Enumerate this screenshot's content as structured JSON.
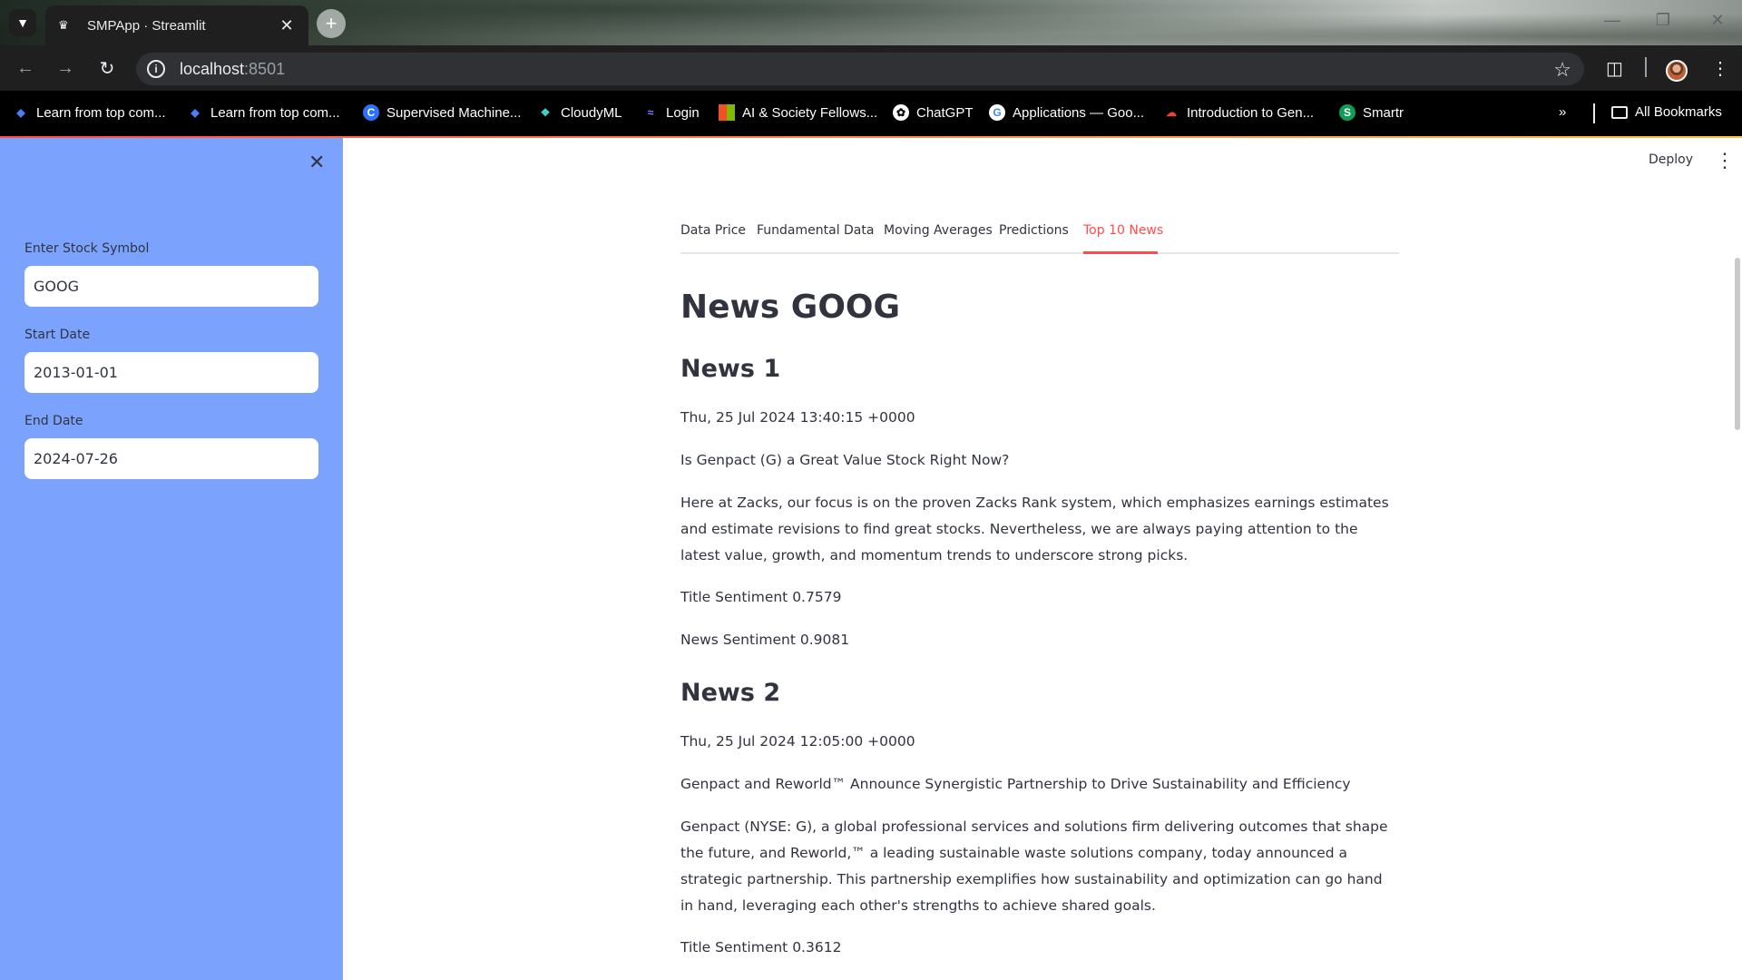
{
  "browser": {
    "tab_title": "SMPApp · Streamlit",
    "url_host": "localhost",
    "url_port": ":8501",
    "bookmarks": [
      {
        "label": "Learn from top com...",
        "icon": "coursera-icon",
        "color": "#4f7cf7"
      },
      {
        "label": "Learn from top com...",
        "icon": "coursera-icon",
        "color": "#4f7cf7"
      },
      {
        "label": "Supervised Machine...",
        "icon": "coursera-c-icon",
        "color": "#2a73ff"
      },
      {
        "label": "CloudyML",
        "icon": "cloudyml-icon",
        "color": "#3fd2c7"
      },
      {
        "label": "Login",
        "icon": "login-icon",
        "color": "#7b8cff"
      },
      {
        "label": "AI & Society Fellows...",
        "icon": "microsoft-icon",
        "color": "#f25022"
      },
      {
        "label": "ChatGPT",
        "icon": "openai-icon",
        "color": "#ffffff"
      },
      {
        "label": "Applications — Goo...",
        "icon": "google-icon",
        "color": "#4285f4"
      },
      {
        "label": "Introduction to Gen...",
        "icon": "google-cloud-icon",
        "color": "#ea4335"
      },
      {
        "label": "Smartr",
        "icon": "smartr-icon",
        "color": "#0f9d58"
      }
    ],
    "all_bookmarks_label": "All Bookmarks"
  },
  "sidebar": {
    "symbol_label": "Enter Stock Symbol",
    "symbol_value": "GOOG",
    "start_label": "Start Date",
    "start_value": "2013-01-01",
    "end_label": "End Date",
    "end_value": "2024-07-26"
  },
  "header": {
    "deploy_label": "Deploy"
  },
  "tabs": [
    "Data Price",
    "Fundamental Data",
    "Moving Averages",
    "Predictions",
    "Top 10 News"
  ],
  "active_tab": "Top 10 News",
  "colors": {
    "accent": "#ff4b4b",
    "sidebar_bg": "#7ba3fd",
    "text": "#31333f"
  },
  "content": {
    "heading": "News GOOG",
    "news": [
      {
        "title": "News 1",
        "date": "Thu, 25 Jul 2024 13:40:15 +0000",
        "headline": "Is Genpact (G) a Great Value Stock Right Now?",
        "summary": "Here at Zacks, our focus is on the proven Zacks Rank system, which emphasizes earnings estimates and estimate revisions to find great stocks. Nevertheless, we are always paying attention to the latest value, growth, and momentum trends to underscore strong picks.",
        "title_sentiment": "Title Sentiment 0.7579",
        "news_sentiment": "News Sentiment 0.9081"
      },
      {
        "title": "News 2",
        "date": "Thu, 25 Jul 2024 12:05:00 +0000",
        "headline": "Genpact and Reworld™ Announce Synergistic Partnership to Drive Sustainability and Efficiency",
        "summary": "Genpact (NYSE: G), a global professional services and solutions firm delivering outcomes that shape the future, and Reworld,™ a leading sustainable waste solutions company, today announced a strategic partnership. This partnership exemplifies how sustainability and optimization can go hand in hand, leveraging each other's strengths to achieve shared goals.",
        "title_sentiment": "Title Sentiment 0.3612"
      }
    ]
  }
}
